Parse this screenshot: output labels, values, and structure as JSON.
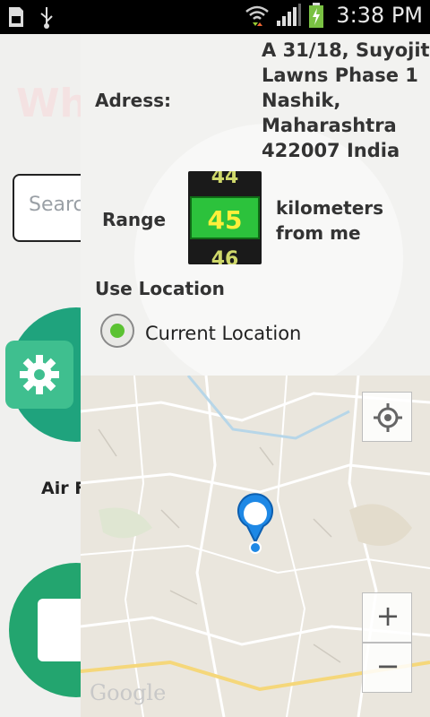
{
  "status_bar": {
    "time": "3:38 PM"
  },
  "background": {
    "heading": "Wh",
    "search_placeholder": "Searc",
    "app_label": "Air F"
  },
  "form": {
    "address_label": "Adress:",
    "address_lines": [
      "A 31/18, Suyojit",
      "Lawns Phase 1",
      "Nashik,",
      "Maharashtra",
      "422007 India"
    ],
    "range_label": "Range",
    "picker": {
      "prev": "44",
      "current": "45",
      "next": "46"
    },
    "range_unit_line1": "kilometers",
    "range_unit_line2": "from me",
    "use_location_label": "Use Location",
    "radio_label": "Current Location"
  },
  "map": {
    "zoom_in": "+",
    "zoom_out": "−",
    "attribution": "Google",
    "accent": "#1e88e5"
  }
}
